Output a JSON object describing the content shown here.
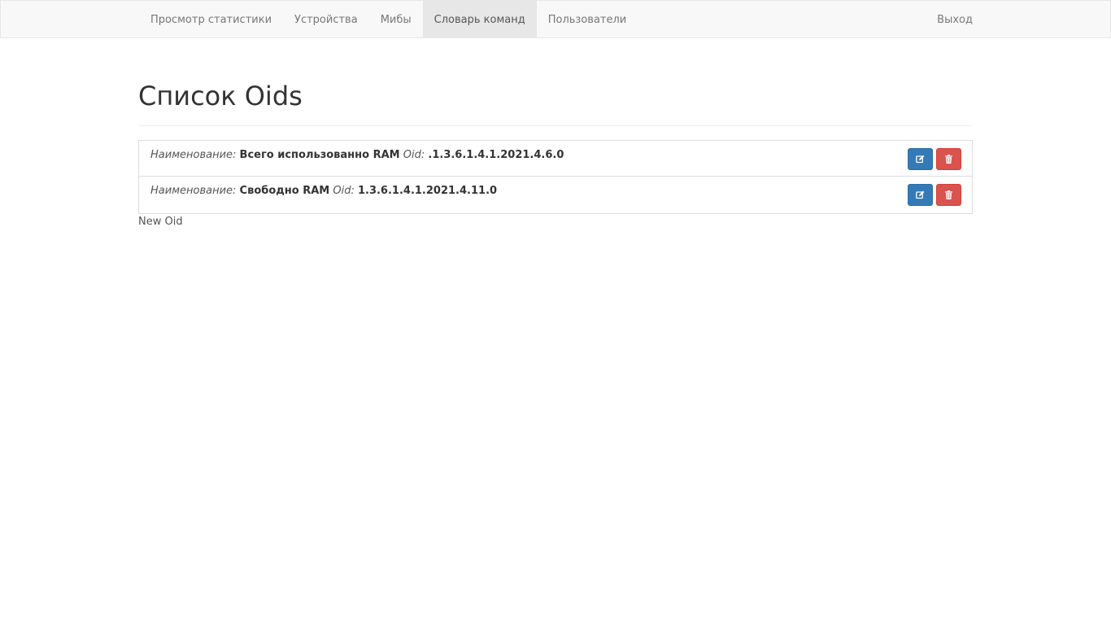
{
  "navbar": {
    "items": [
      {
        "label": "Просмотр статистики"
      },
      {
        "label": "Устройства"
      },
      {
        "label": "Мибы"
      },
      {
        "label": "Словарь команд"
      },
      {
        "label": "Пользователи"
      }
    ],
    "active_index": 3,
    "logout_label": "Выход"
  },
  "page": {
    "title": "Список Oids"
  },
  "oids": [
    {
      "name_label": "Наименование:",
      "name": "Всего использованно RAM",
      "oid_label": "Oid:",
      "oid": ".1.3.6.1.4.1.2021.4.6.0"
    },
    {
      "name_label": "Наименование:",
      "name": "Свободно RAM",
      "oid_label": "Oid:",
      "oid": "1.3.6.1.4.1.2021.4.11.0"
    }
  ],
  "actions": {
    "new_oid_label": "New Oid",
    "edit_icon": "edit-icon",
    "delete_icon": "trash-icon"
  },
  "colors": {
    "edit_button": "#337ab7",
    "delete_button": "#d9534f",
    "navbar_bg": "#f8f8f8",
    "active_tab_bg": "#e7e7e7"
  }
}
